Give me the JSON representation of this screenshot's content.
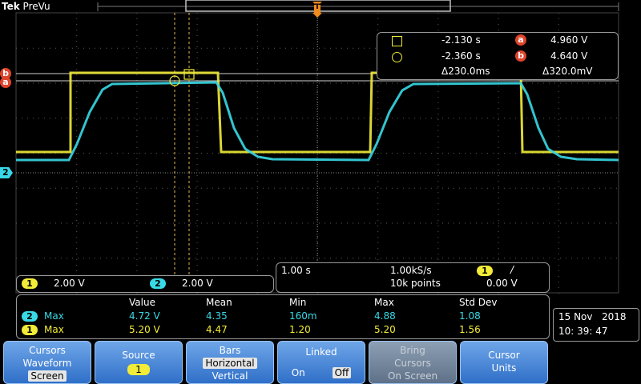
{
  "brand": {
    "name": "Tek",
    "mode": "PreVu"
  },
  "trigger_marker": {
    "label": "T"
  },
  "cursor_readout": {
    "square_time": "-2.130 s",
    "circle_time": "-2.360 s",
    "a_label": "a",
    "b_label": "b",
    "a_value": "4.960 V",
    "b_value": "4.640 V",
    "delta_time": "Δ230.0ms",
    "delta_volt": "Δ320.0mV"
  },
  "ref_markers": {
    "a": "a",
    "b": "b",
    "ch2": "2"
  },
  "channels": {
    "ch1": {
      "badge": "1",
      "scale": "2.00 V",
      "color": "#f2ec38"
    },
    "ch2": {
      "badge": "2",
      "scale": "2.00 V",
      "color": "#38d9e6"
    }
  },
  "timebase": {
    "time_div": "1.00 s",
    "sample_rate": "1.00kS/s",
    "record_length": "10k points",
    "trigger_source": "1",
    "trigger_slope": "/",
    "trigger_level": "0.00 V"
  },
  "measurements": {
    "headers": [
      "Value",
      "Mean",
      "Min",
      "Max",
      "Std Dev"
    ],
    "rows": [
      {
        "channel": "2",
        "name": "Max",
        "value": "4.72 V",
        "mean": "4.35",
        "min": "160m",
        "max": "4.88",
        "std": "1.08"
      },
      {
        "channel": "1",
        "name": "Max",
        "value": "5.20 V",
        "mean": "4.47",
        "min": "1.20",
        "max": "5.20",
        "std": "1.56"
      }
    ]
  },
  "datetime": {
    "date": "15 Nov   2018",
    "time": "10: 39: 47"
  },
  "softkeys": {
    "cursors": {
      "title": "Cursors",
      "line2": "Waveform",
      "line3": "Screen"
    },
    "source": {
      "title": "Source",
      "value": "1"
    },
    "bars": {
      "title": "Bars",
      "opt1": "Horizontal",
      "opt2": "Vertical"
    },
    "linked": {
      "title": "Linked",
      "on": "On",
      "off": "Off"
    },
    "bring": {
      "line1": "Bring",
      "line2": "Cursors",
      "line3": "On Screen"
    },
    "units": {
      "line1": "Cursor",
      "line2": "Units"
    }
  },
  "colors": {
    "ch1": "#f2ec38",
    "ch2": "#38d9e6",
    "cursor_badge": "#e0442a",
    "softkey": "#2f6fc8"
  }
}
